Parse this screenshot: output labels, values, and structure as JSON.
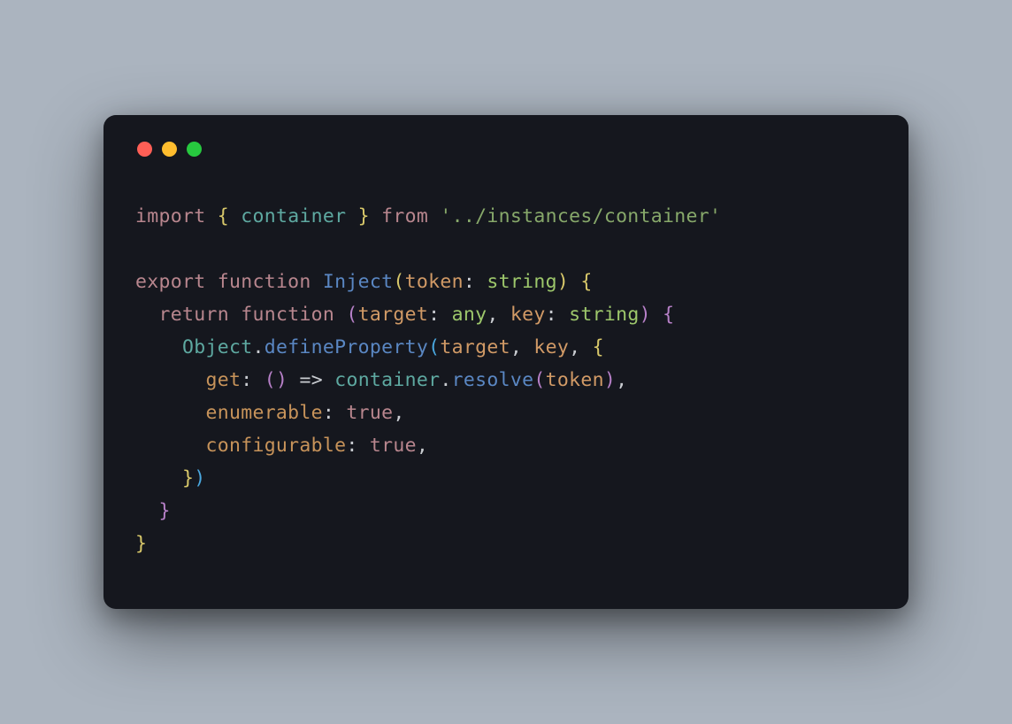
{
  "window": {
    "traffic_lights": [
      "red",
      "yellow",
      "green"
    ]
  },
  "code": {
    "tokens": {
      "import": "import",
      "container": "container",
      "from": "from",
      "path_string": "'../instances/container'",
      "export": "export",
      "function": "function",
      "Inject": "Inject",
      "token": "token",
      "string": "string",
      "return": "return",
      "target": "target",
      "any": "any",
      "key": "key",
      "Object": "Object",
      "defineProperty": "defineProperty",
      "get": "get",
      "resolve": "resolve",
      "enumerable": "enumerable",
      "true": "true",
      "configurable": "configurable"
    }
  }
}
